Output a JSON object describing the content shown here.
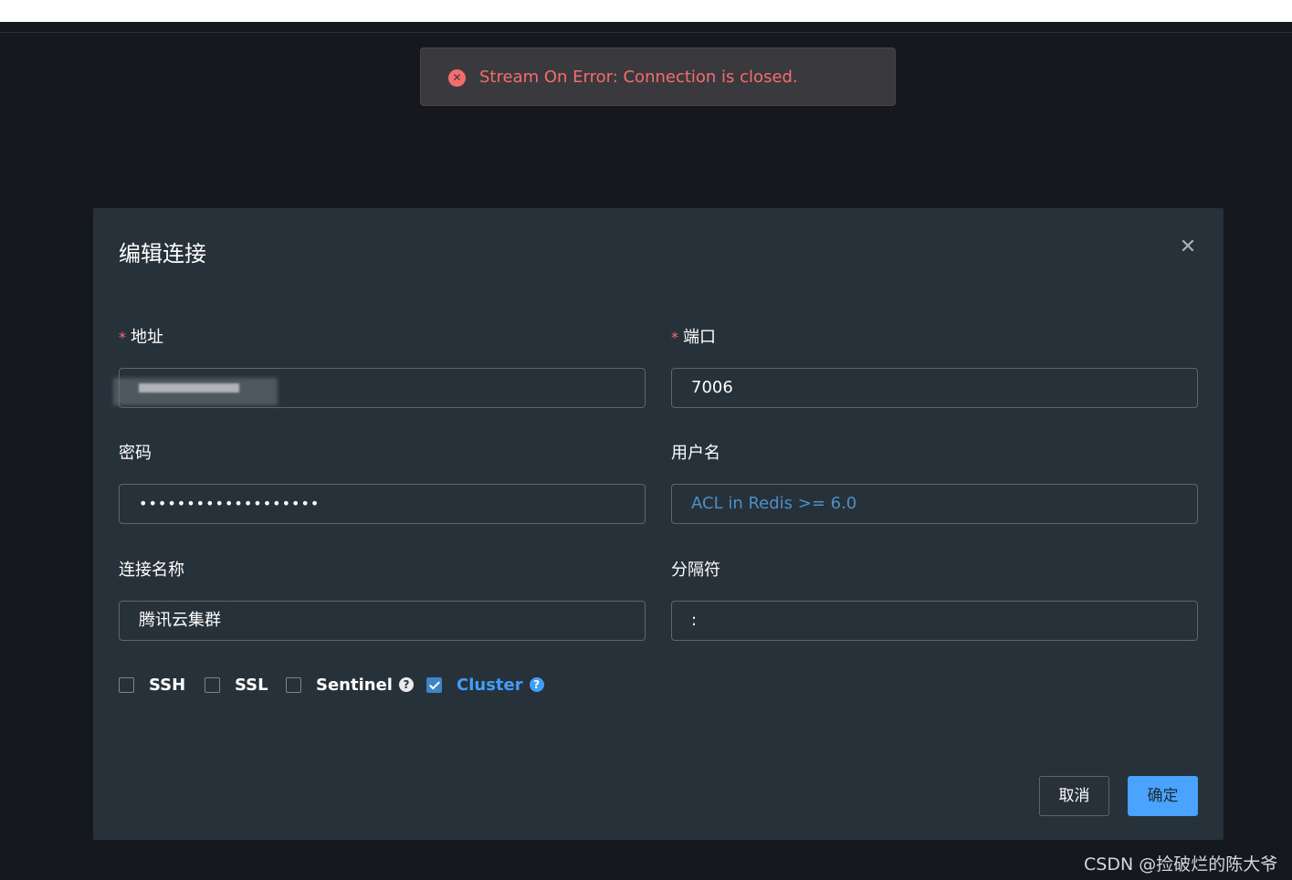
{
  "toast": {
    "message": "Stream On Error: Connection is closed.",
    "icon": "error-circle-icon",
    "color": "#f56c6c"
  },
  "dialog": {
    "title": "编辑连接",
    "close_icon": "close-icon",
    "fields": {
      "address": {
        "label": "地址",
        "required": true,
        "value": ""
      },
      "port": {
        "label": "端口",
        "required": true,
        "value": "7006"
      },
      "password": {
        "label": "密码",
        "value": "•••••••••••••••••••"
      },
      "username": {
        "label": "用户名",
        "placeholder": "ACL in Redis >= 6.0"
      },
      "connection_name": {
        "label": "连接名称",
        "value": "腾讯云集群"
      },
      "separator": {
        "label": "分隔符",
        "value": ":"
      }
    },
    "options": [
      {
        "label": "SSH",
        "checked": false,
        "help": false
      },
      {
        "label": "SSL",
        "checked": false,
        "help": false
      },
      {
        "label": "Sentinel",
        "checked": false,
        "help": true
      },
      {
        "label": "Cluster",
        "checked": true,
        "help": true
      }
    ],
    "buttons": {
      "cancel": "取消",
      "ok": "确定"
    },
    "accent_color": "#409eff"
  },
  "watermark": "CSDN @捡破烂的陈大爷"
}
